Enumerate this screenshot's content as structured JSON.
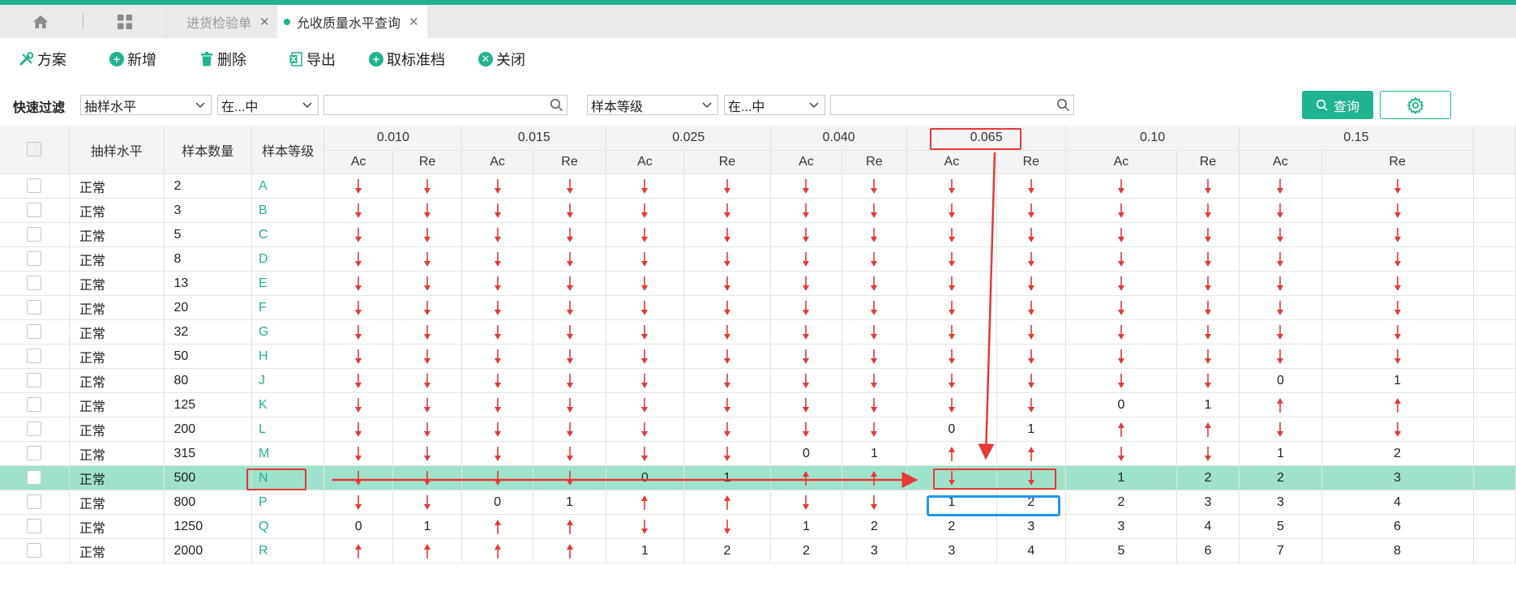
{
  "colors": {
    "accent": "#1fb38f",
    "arrow": "#e53935",
    "highlight_row": "#9fe2cc",
    "annotation_red": "#e53935",
    "annotation_blue": "#2196f3"
  },
  "tabs": [
    {
      "label": "进货检验单",
      "active": false
    },
    {
      "label": "允收质量水平查询",
      "active": true
    }
  ],
  "toolbar": {
    "scheme": "方案",
    "add": "新增",
    "delete": "删除",
    "export": "导出",
    "cancel_mark": "取标准档",
    "close": "关闭"
  },
  "filter": {
    "label": "快速过滤",
    "field1": "抽样水平",
    "op1": "在...中",
    "value1": "",
    "field2": "样本等级",
    "op2": "在...中",
    "value2": "",
    "query": "查询"
  },
  "columns": {
    "level": "抽样水平",
    "size": "样本数量",
    "grade": "样本等级",
    "ac": "Ac",
    "re": "Re"
  },
  "aql_levels": [
    "0.010",
    "0.015",
    "0.025",
    "0.040",
    "0.065",
    "0.10",
    "0.15"
  ],
  "rows": [
    {
      "level": "正常",
      "size": "2",
      "grade": "A",
      "cells": [
        "d",
        "d",
        "d",
        "d",
        "d",
        "d",
        "d",
        "d",
        "d",
        "d",
        "d",
        "d",
        "d",
        "d"
      ]
    },
    {
      "level": "正常",
      "size": "3",
      "grade": "B",
      "cells": [
        "d",
        "d",
        "d",
        "d",
        "d",
        "d",
        "d",
        "d",
        "d",
        "d",
        "d",
        "d",
        "d",
        "d"
      ]
    },
    {
      "level": "正常",
      "size": "5",
      "grade": "C",
      "cells": [
        "d",
        "d",
        "d",
        "d",
        "d",
        "d",
        "d",
        "d",
        "d",
        "d",
        "d",
        "d",
        "d",
        "d"
      ]
    },
    {
      "level": "正常",
      "size": "8",
      "grade": "D",
      "cells": [
        "d",
        "d",
        "d",
        "d",
        "d",
        "d",
        "d",
        "d",
        "d",
        "d",
        "d",
        "d",
        "d",
        "d"
      ]
    },
    {
      "level": "正常",
      "size": "13",
      "grade": "E",
      "cells": [
        "d",
        "d",
        "d",
        "d",
        "d",
        "d",
        "d",
        "d",
        "d",
        "d",
        "d",
        "d",
        "d",
        "d"
      ]
    },
    {
      "level": "正常",
      "size": "20",
      "grade": "F",
      "cells": [
        "d",
        "d",
        "d",
        "d",
        "d",
        "d",
        "d",
        "d",
        "d",
        "d",
        "d",
        "d",
        "d",
        "d"
      ]
    },
    {
      "level": "正常",
      "size": "32",
      "grade": "G",
      "cells": [
        "d",
        "d",
        "d",
        "d",
        "d",
        "d",
        "d",
        "d",
        "d",
        "d",
        "d",
        "d",
        "d",
        "d"
      ]
    },
    {
      "level": "正常",
      "size": "50",
      "grade": "H",
      "cells": [
        "d",
        "d",
        "d",
        "d",
        "d",
        "d",
        "d",
        "d",
        "d",
        "d",
        "d",
        "d",
        "d",
        "d"
      ]
    },
    {
      "level": "正常",
      "size": "80",
      "grade": "J",
      "cells": [
        "d",
        "d",
        "d",
        "d",
        "d",
        "d",
        "d",
        "d",
        "d",
        "d",
        "d",
        "d",
        "0",
        "1"
      ]
    },
    {
      "level": "正常",
      "size": "125",
      "grade": "K",
      "cells": [
        "d",
        "d",
        "d",
        "d",
        "d",
        "d",
        "d",
        "d",
        "d",
        "d",
        "0",
        "1",
        "u",
        "u"
      ]
    },
    {
      "level": "正常",
      "size": "200",
      "grade": "L",
      "cells": [
        "d",
        "d",
        "d",
        "d",
        "d",
        "d",
        "d",
        "d",
        "0",
        "1",
        "u",
        "u",
        "d",
        "d"
      ]
    },
    {
      "level": "正常",
      "size": "315",
      "grade": "M",
      "cells": [
        "d",
        "d",
        "d",
        "d",
        "d",
        "d",
        "0",
        "1",
        "u",
        "u",
        "d",
        "d",
        "1",
        "2"
      ]
    },
    {
      "level": "正常",
      "size": "500",
      "grade": "N",
      "cells": [
        "d",
        "d",
        "d",
        "d",
        "0",
        "1",
        "u",
        "u",
        "d",
        "d",
        "1",
        "2",
        "2",
        "3"
      ],
      "selected": true
    },
    {
      "level": "正常",
      "size": "800",
      "grade": "P",
      "cells": [
        "d",
        "d",
        "0",
        "1",
        "u",
        "u",
        "d",
        "d",
        "1",
        "2",
        "2",
        "3",
        "3",
        "4"
      ]
    },
    {
      "level": "正常",
      "size": "1250",
      "grade": "Q",
      "cells": [
        "0",
        "1",
        "u",
        "u",
        "d",
        "d",
        "1",
        "2",
        "2",
        "3",
        "3",
        "4",
        "5",
        "6"
      ]
    },
    {
      "level": "正常",
      "size": "2000",
      "grade": "R",
      "cells": [
        "u",
        "u",
        "u",
        "u",
        "1",
        "2",
        "2",
        "3",
        "3",
        "4",
        "5",
        "6",
        "7",
        "8"
      ]
    }
  ]
}
